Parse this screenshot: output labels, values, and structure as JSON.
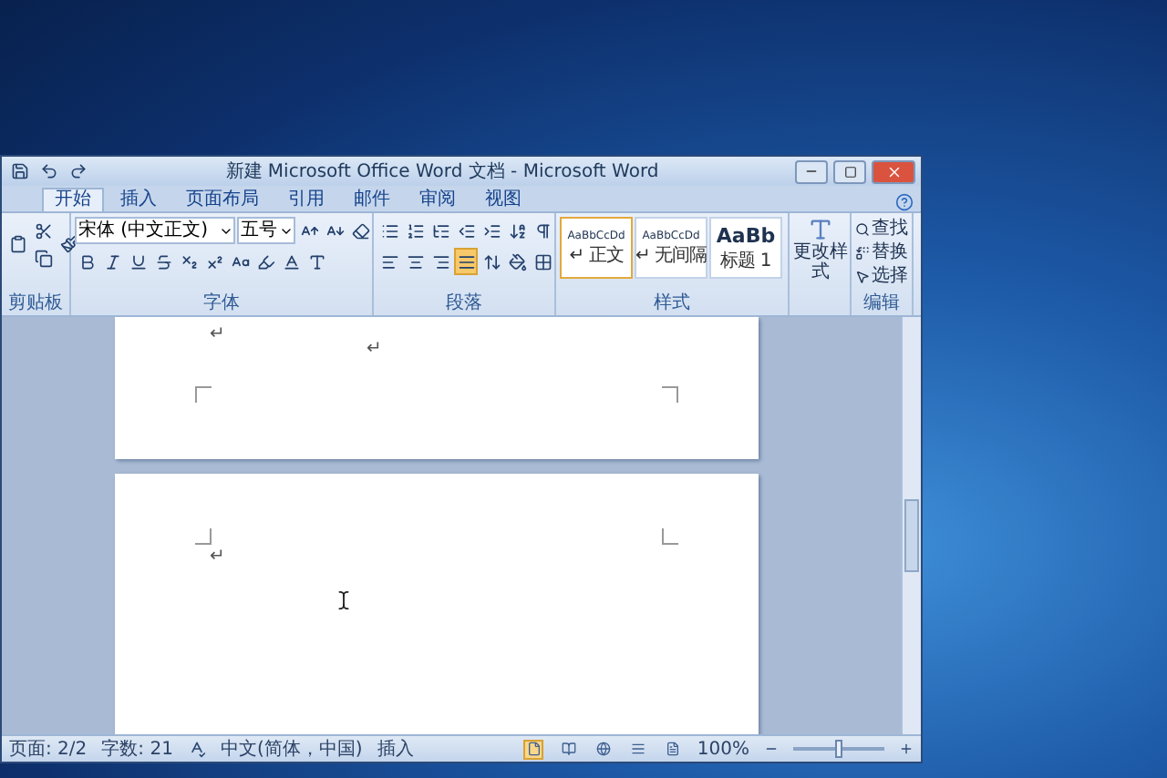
{
  "window": {
    "title": "新建 Microsoft Office Word 文档 - Microsoft Word"
  },
  "tabs": [
    {
      "label": "开始",
      "selected": true
    },
    {
      "label": "插入",
      "selected": false
    },
    {
      "label": "页面布局",
      "selected": false
    },
    {
      "label": "引用",
      "selected": false
    },
    {
      "label": "邮件",
      "selected": false
    },
    {
      "label": "审阅",
      "selected": false
    },
    {
      "label": "视图",
      "selected": false
    }
  ],
  "ribbon": {
    "font": {
      "name": "宋体 (中文正文)",
      "size": "五号"
    },
    "alignments": [
      {
        "kind": "left",
        "selected": false
      },
      {
        "kind": "center",
        "selected": false
      },
      {
        "kind": "right",
        "selected": false
      },
      {
        "kind": "justify",
        "selected": true
      }
    ],
    "styles": [
      {
        "preview": "AaBbCcDd",
        "name": "↵ 正文",
        "kind": "body",
        "selected": true
      },
      {
        "preview": "AaBbCcDd",
        "name": "↵ 无间隔",
        "kind": "body",
        "selected": false
      },
      {
        "preview": "AaBb",
        "name": "标题 1",
        "kind": "heading",
        "selected": false
      }
    ],
    "change_styles": "更改样式",
    "editing": [
      {
        "kind": "find",
        "label": "查找"
      },
      {
        "kind": "replace",
        "label": "替换"
      },
      {
        "kind": "select",
        "label": "选择"
      }
    ],
    "groups": [
      "剪贴板",
      "字体",
      "段落",
      "样式",
      "编辑"
    ]
  },
  "pages": [
    {
      "marks": [
        "↵",
        "↵"
      ]
    },
    {
      "marks": [
        "↵"
      ]
    }
  ],
  "status_bar": {
    "page": "页面: 2/2",
    "words": "字数: 21",
    "language": "中文(简体，中国)",
    "mode": "插入",
    "zoom": "100%",
    "zoom_level": {
      "level": 0.5
    },
    "views": [
      {
        "selected": true
      },
      {
        "selected": false
      },
      {
        "selected": false
      },
      {
        "selected": false
      },
      {
        "selected": false
      }
    ]
  }
}
